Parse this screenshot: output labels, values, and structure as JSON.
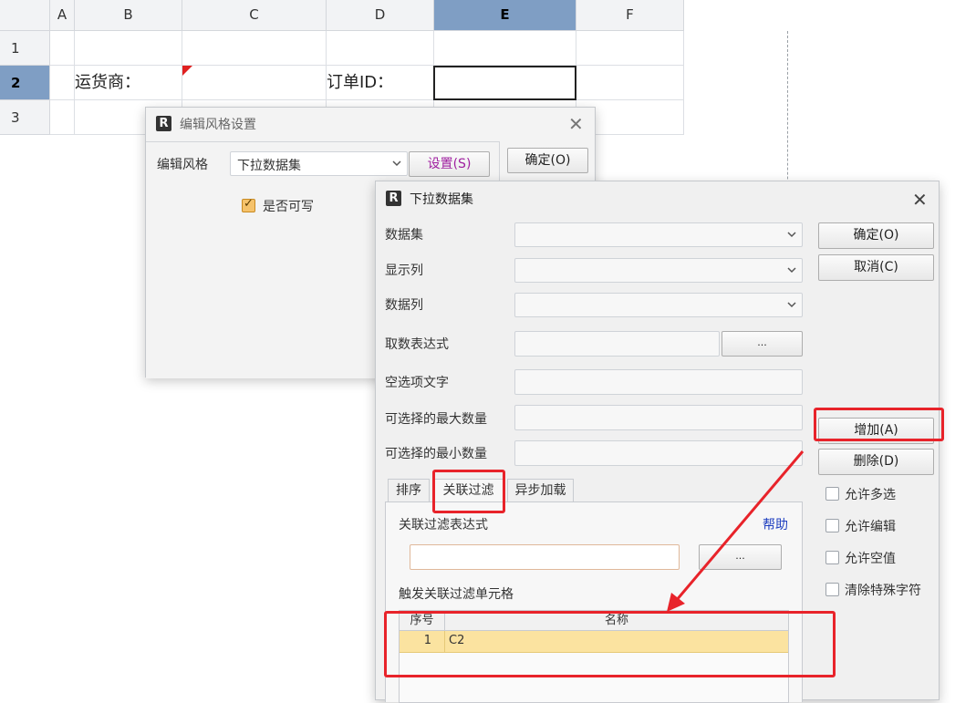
{
  "sheet": {
    "columns": [
      "A",
      "B",
      "C",
      "D",
      "E",
      "F"
    ],
    "rows": [
      "1",
      "2",
      "3"
    ],
    "cells": {
      "b2": "运货商：",
      "d2": "订单ID："
    }
  },
  "edit_style_dialog": {
    "title": "编辑风格设置",
    "style_label": "编辑风格",
    "style_value": "下拉数据集",
    "settings_button": "设置(S)",
    "ok_button": "确定(O)",
    "writable_label": "是否可写",
    "writable_checked": true
  },
  "dropdown_dialog": {
    "title": "下拉数据集",
    "fields": {
      "dataset": "数据集",
      "display_column": "显示列",
      "data_column": "数据列",
      "fetch_expression": "取数表达式",
      "empty_option_text": "空选项文字",
      "max_selectable": "可选择的最大数量",
      "min_selectable": "可选择的最小数量"
    },
    "ellipsis": "...",
    "buttons": {
      "ok": "确定(O)",
      "cancel": "取消(C)",
      "add": "增加(A)",
      "delete": "删除(D)"
    },
    "options": [
      {
        "label": "允许多选",
        "checked": false
      },
      {
        "label": "允许编辑",
        "checked": false
      },
      {
        "label": "允许空值",
        "checked": false
      },
      {
        "label": "清除特殊字符",
        "checked": false
      }
    ],
    "tabs": [
      "排序",
      "关联过滤",
      "异步加载"
    ],
    "active_tab": "关联过滤",
    "filter_expression_label": "关联过滤表达式",
    "help_link": "帮助",
    "trigger_cells_label": "触发关联过滤单元格",
    "table": {
      "headers": [
        "序号",
        "名称"
      ],
      "rows": [
        {
          "index": "1",
          "name": "C2"
        }
      ]
    }
  },
  "colors": {
    "selected_header": "#7f9ec4",
    "highlight": "#e8232a",
    "row_selected": "#fbe3a0",
    "link": "#2040c0"
  }
}
